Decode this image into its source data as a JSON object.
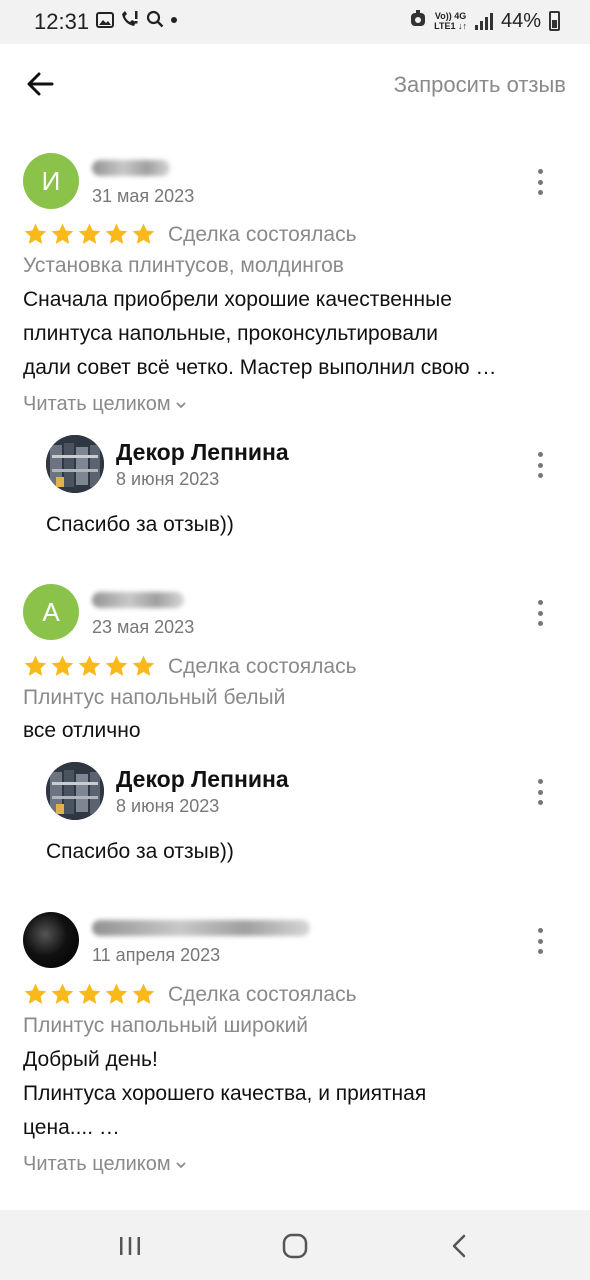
{
  "status_bar": {
    "time": "12:31",
    "network_top": "Vo)) 4G",
    "network_bottom": "LTE1 ↓↑",
    "battery": "44%"
  },
  "header": {
    "back_icon": "arrow-left-icon",
    "request_review_label": "Запросить отзыв"
  },
  "reviews": [
    {
      "avatar_letter": "И",
      "avatar_color": "#8bc34a",
      "date": "31 мая 2023",
      "rating": 5,
      "deal_status": "Сделка состоялась",
      "service": "Установка плинтусов, молдингов",
      "text_lines": [
        "Сначала приобрели хорошие качественные",
        "плинтуса напольные, проконсультировали",
        "дали совет всё четко. Мастер выполнил свою …"
      ],
      "read_more": "Читать целиком",
      "reply": {
        "name": "Декор Лепнина",
        "date": "8 июня 2023",
        "text": "Спасибо за отзыв))"
      }
    },
    {
      "avatar_letter": "А",
      "avatar_color": "#8bc34a",
      "date": "23 мая 2023",
      "rating": 5,
      "deal_status": "Сделка состоялась",
      "service": "Плинтус напольный белый",
      "text_lines": [
        "все отлично"
      ],
      "reply": {
        "name": "Декор Лепнина",
        "date": "8 июня 2023",
        "text": "Спасибо за отзыв))"
      }
    },
    {
      "avatar_letter": "",
      "date": "11 апреля 2023",
      "rating": 5,
      "deal_status": "Сделка состоялась",
      "service": "Плинтус напольный широкий",
      "text_lines": [
        "Добрый день!",
        "Плинтуса хорошего качества, и приятная",
        "цена.... …"
      ],
      "read_more": "Читать целиком"
    }
  ],
  "colors": {
    "star": "#f9b91b",
    "avatar_green": "#8bc34a",
    "muted_text": "#8a8a8a"
  },
  "nav_bar": {
    "icons": [
      "recent-apps-icon",
      "home-icon",
      "back-icon"
    ]
  }
}
